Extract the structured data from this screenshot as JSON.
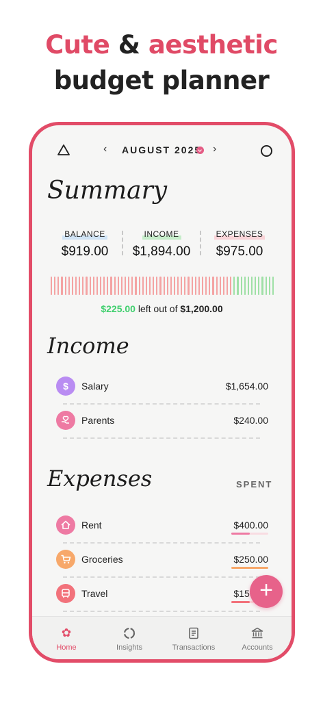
{
  "headline": {
    "word1": "Cute",
    "amp": "&",
    "word2": "aesthetic",
    "line2": "budget planner"
  },
  "topbar": {
    "month": "AUGUST 2025",
    "prev_icon": "chevron-left-icon",
    "next_icon": "chevron-right-icon"
  },
  "summary": {
    "title": "Summary",
    "balance_label": "BALANCE",
    "balance_value": "$919.00",
    "income_label": "INCOME",
    "income_value": "$1,894.00",
    "expenses_label": "EXPENSES",
    "expenses_value": "$975.00",
    "budget_left": "$225.00",
    "budget_middle": "left out of",
    "budget_total": "$1,200.00",
    "spent_fraction": 0.8125,
    "colors": {
      "spent": "#f4a3a3",
      "left": "#9fe0a6"
    }
  },
  "income": {
    "title": "Income",
    "items": [
      {
        "name": "Salary",
        "amount": "$1,654.00",
        "icon": "dollar-icon",
        "color": "#b98cf2"
      },
      {
        "name": "Parents",
        "amount": "$240.00",
        "icon": "gift-hand-icon",
        "color": "#ee7aa3"
      }
    ]
  },
  "expenses": {
    "title": "Expenses",
    "column_label": "SPENT",
    "items": [
      {
        "name": "Rent",
        "amount": "$400.00",
        "icon": "home-icon",
        "color": "#ee7aa3",
        "progress": 0.5
      },
      {
        "name": "Groceries",
        "amount": "$250.00",
        "icon": "cart-icon",
        "color": "#f7a86a",
        "progress": 1.0
      },
      {
        "name": "Travel",
        "amount": "$150.00",
        "icon": "bus-icon",
        "color": "#f2727b",
        "progress": 0.5
      }
    ]
  },
  "fab": {
    "label": "+"
  },
  "tabbar": {
    "tabs": [
      {
        "label": "Home",
        "icon": "flower-icon",
        "active": true
      },
      {
        "label": "Insights",
        "icon": "pie-ring-icon",
        "active": false
      },
      {
        "label": "Transactions",
        "icon": "receipt-icon",
        "active": false
      },
      {
        "label": "Accounts",
        "icon": "bank-icon",
        "active": false
      }
    ]
  },
  "accent_color": "#e24c68"
}
